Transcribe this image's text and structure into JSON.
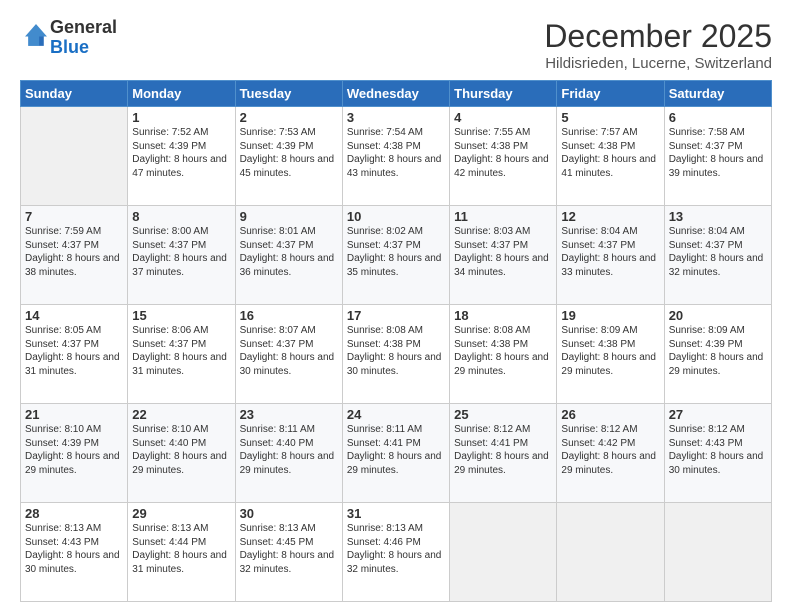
{
  "header": {
    "logo": {
      "general": "General",
      "blue": "Blue"
    },
    "title": "December 2025",
    "location": "Hildisrieden, Lucerne, Switzerland"
  },
  "weekdays": [
    "Sunday",
    "Monday",
    "Tuesday",
    "Wednesday",
    "Thursday",
    "Friday",
    "Saturday"
  ],
  "weeks": [
    [
      {
        "day": "",
        "empty": true
      },
      {
        "day": "1",
        "sunrise": "7:52 AM",
        "sunset": "4:39 PM",
        "daylight": "8 hours and 47 minutes."
      },
      {
        "day": "2",
        "sunrise": "7:53 AM",
        "sunset": "4:39 PM",
        "daylight": "8 hours and 45 minutes."
      },
      {
        "day": "3",
        "sunrise": "7:54 AM",
        "sunset": "4:38 PM",
        "daylight": "8 hours and 43 minutes."
      },
      {
        "day": "4",
        "sunrise": "7:55 AM",
        "sunset": "4:38 PM",
        "daylight": "8 hours and 42 minutes."
      },
      {
        "day": "5",
        "sunrise": "7:57 AM",
        "sunset": "4:38 PM",
        "daylight": "8 hours and 41 minutes."
      },
      {
        "day": "6",
        "sunrise": "7:58 AM",
        "sunset": "4:37 PM",
        "daylight": "8 hours and 39 minutes."
      }
    ],
    [
      {
        "day": "7",
        "sunrise": "7:59 AM",
        "sunset": "4:37 PM",
        "daylight": "8 hours and 38 minutes."
      },
      {
        "day": "8",
        "sunrise": "8:00 AM",
        "sunset": "4:37 PM",
        "daylight": "8 hours and 37 minutes."
      },
      {
        "day": "9",
        "sunrise": "8:01 AM",
        "sunset": "4:37 PM",
        "daylight": "8 hours and 36 minutes."
      },
      {
        "day": "10",
        "sunrise": "8:02 AM",
        "sunset": "4:37 PM",
        "daylight": "8 hours and 35 minutes."
      },
      {
        "day": "11",
        "sunrise": "8:03 AM",
        "sunset": "4:37 PM",
        "daylight": "8 hours and 34 minutes."
      },
      {
        "day": "12",
        "sunrise": "8:04 AM",
        "sunset": "4:37 PM",
        "daylight": "8 hours and 33 minutes."
      },
      {
        "day": "13",
        "sunrise": "8:04 AM",
        "sunset": "4:37 PM",
        "daylight": "8 hours and 32 minutes."
      }
    ],
    [
      {
        "day": "14",
        "sunrise": "8:05 AM",
        "sunset": "4:37 PM",
        "daylight": "8 hours and 31 minutes."
      },
      {
        "day": "15",
        "sunrise": "8:06 AM",
        "sunset": "4:37 PM",
        "daylight": "8 hours and 31 minutes."
      },
      {
        "day": "16",
        "sunrise": "8:07 AM",
        "sunset": "4:37 PM",
        "daylight": "8 hours and 30 minutes."
      },
      {
        "day": "17",
        "sunrise": "8:08 AM",
        "sunset": "4:38 PM",
        "daylight": "8 hours and 30 minutes."
      },
      {
        "day": "18",
        "sunrise": "8:08 AM",
        "sunset": "4:38 PM",
        "daylight": "8 hours and 29 minutes."
      },
      {
        "day": "19",
        "sunrise": "8:09 AM",
        "sunset": "4:38 PM",
        "daylight": "8 hours and 29 minutes."
      },
      {
        "day": "20",
        "sunrise": "8:09 AM",
        "sunset": "4:39 PM",
        "daylight": "8 hours and 29 minutes."
      }
    ],
    [
      {
        "day": "21",
        "sunrise": "8:10 AM",
        "sunset": "4:39 PM",
        "daylight": "8 hours and 29 minutes."
      },
      {
        "day": "22",
        "sunrise": "8:10 AM",
        "sunset": "4:40 PM",
        "daylight": "8 hours and 29 minutes."
      },
      {
        "day": "23",
        "sunrise": "8:11 AM",
        "sunset": "4:40 PM",
        "daylight": "8 hours and 29 minutes."
      },
      {
        "day": "24",
        "sunrise": "8:11 AM",
        "sunset": "4:41 PM",
        "daylight": "8 hours and 29 minutes."
      },
      {
        "day": "25",
        "sunrise": "8:12 AM",
        "sunset": "4:41 PM",
        "daylight": "8 hours and 29 minutes."
      },
      {
        "day": "26",
        "sunrise": "8:12 AM",
        "sunset": "4:42 PM",
        "daylight": "8 hours and 29 minutes."
      },
      {
        "day": "27",
        "sunrise": "8:12 AM",
        "sunset": "4:43 PM",
        "daylight": "8 hours and 30 minutes."
      }
    ],
    [
      {
        "day": "28",
        "sunrise": "8:13 AM",
        "sunset": "4:43 PM",
        "daylight": "8 hours and 30 minutes."
      },
      {
        "day": "29",
        "sunrise": "8:13 AM",
        "sunset": "4:44 PM",
        "daylight": "8 hours and 31 minutes."
      },
      {
        "day": "30",
        "sunrise": "8:13 AM",
        "sunset": "4:45 PM",
        "daylight": "8 hours and 32 minutes."
      },
      {
        "day": "31",
        "sunrise": "8:13 AM",
        "sunset": "4:46 PM",
        "daylight": "8 hours and 32 minutes."
      },
      {
        "day": "",
        "empty": true
      },
      {
        "day": "",
        "empty": true
      },
      {
        "day": "",
        "empty": true
      }
    ]
  ],
  "labels": {
    "sunrise_prefix": "Sunrise: ",
    "sunset_prefix": "Sunset: ",
    "daylight_prefix": "Daylight: "
  },
  "colors": {
    "header_bg": "#2a6dba",
    "accent": "#1a6fc4"
  }
}
